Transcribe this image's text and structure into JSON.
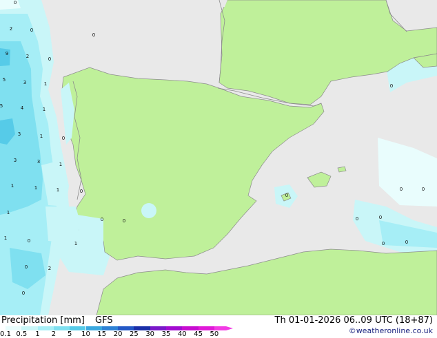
{
  "map": {
    "colors": {
      "sea": "#e9e9e9",
      "land": "#bff09a",
      "border": "#8c8c8c"
    },
    "precip_labels": [
      "0",
      "2",
      "0",
      "0",
      "9",
      "2",
      "0",
      "5",
      "3",
      "1",
      "5",
      "4",
      "1",
      "3",
      "1",
      "0",
      "3",
      "3",
      "1",
      "1",
      "1",
      "1",
      "0",
      "1",
      "0",
      "0",
      "1",
      "0",
      "2",
      "0",
      "1",
      "0",
      "0",
      "0",
      "0",
      "0",
      "0",
      "0",
      "0",
      "0"
    ]
  },
  "footer": {
    "title": "Precipitation [mm]",
    "model": "GFS",
    "datetime": "Th 01-01-2026 06..09 UTC (18+87)",
    "credit": "©weatheronline.co.uk"
  },
  "legend": {
    "ticks": [
      "0.1",
      "0.5",
      "1",
      "2",
      "5",
      "10",
      "15",
      "20",
      "25",
      "30",
      "35",
      "40",
      "45",
      "50"
    ],
    "colors": [
      "#e9fdfd",
      "#c9f6f8",
      "#a6eef6",
      "#7fe0f0",
      "#56cbe8",
      "#3aa8df",
      "#2e82d6",
      "#2358c6",
      "#1a2fa8",
      "#7a18c9",
      "#a20bd0",
      "#c70cd0",
      "#e01ad8",
      "#f23ce4"
    ]
  }
}
